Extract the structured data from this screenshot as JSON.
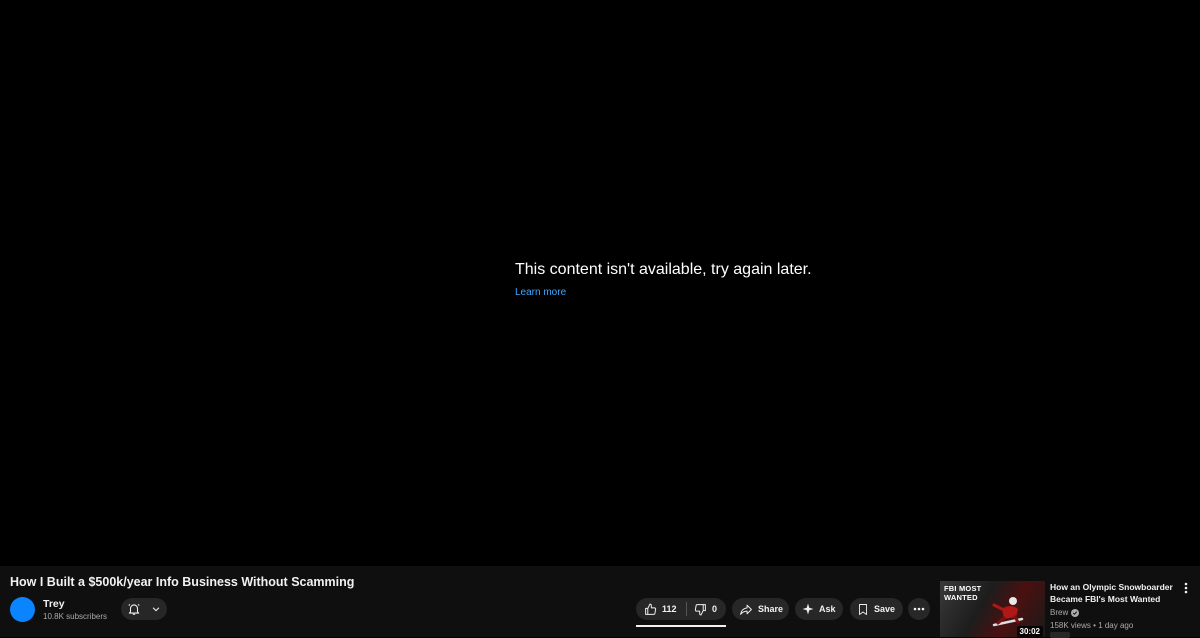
{
  "player": {
    "error_message": "This content isn't available, try again later.",
    "learn_more": "Learn more"
  },
  "video": {
    "title": "How I Built a $500k/year Info Business Without Scamming"
  },
  "channel": {
    "name": "Trey",
    "subscribers": "10.8K subscribers",
    "avatar_color": "#0a84ff"
  },
  "actions": {
    "likes": "112",
    "dislikes": "0",
    "share_label": "Share",
    "ask_label": "Ask",
    "save_label": "Save",
    "icons": [
      "bell-icon",
      "chevron-down-icon",
      "thumbs-up-icon",
      "thumbs-down-icon",
      "share-icon",
      "sparkle-icon",
      "bookmark-icon",
      "more-horizontal-icon"
    ]
  },
  "recommendation": {
    "thumbnail_text": "FBI MOST WANTED",
    "duration": "30:02",
    "title": "How an Olympic Snowboarder Became FBI's Most Wanted",
    "channel": "Brew",
    "verified": true,
    "views": "158K views",
    "age": "1 day ago"
  },
  "colors": {
    "background": "#000000",
    "panel": "#0f0f0f",
    "pill": "#272727",
    "link": "#3ea6ff"
  }
}
